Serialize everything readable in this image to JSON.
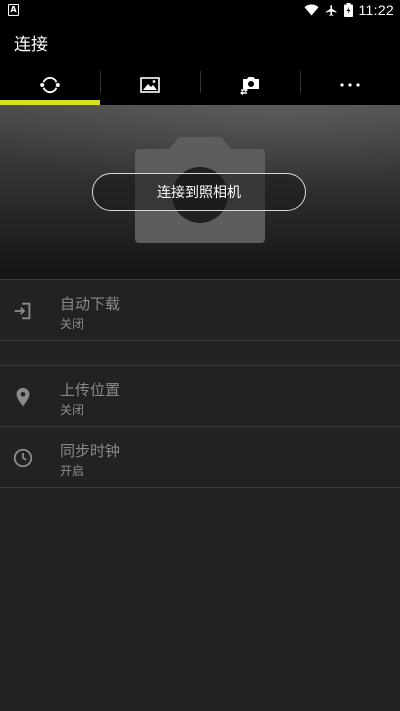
{
  "status_bar": {
    "time": "11:22",
    "icons": [
      "notification-icon",
      "wifi-icon",
      "airplane-icon",
      "battery-icon"
    ]
  },
  "app_bar": {
    "title": "连接"
  },
  "tabs": [
    {
      "icon": "connection-sync-icon",
      "selected": true
    },
    {
      "icon": "image-gallery-icon",
      "selected": false
    },
    {
      "icon": "camera-transfer-icon",
      "selected": false
    },
    {
      "icon": "more-icon",
      "selected": false
    }
  ],
  "accent_color": "#d7df21",
  "hero": {
    "connect_button_label": "连接到照相机"
  },
  "settings": [
    {
      "icon": "auto-download-icon",
      "title": "自动下载",
      "value": "关闭"
    },
    {
      "icon": "location-pin-icon",
      "title": "上传位置",
      "value": "关闭"
    },
    {
      "icon": "clock-icon",
      "title": "同步时钟",
      "value": "开启"
    }
  ]
}
